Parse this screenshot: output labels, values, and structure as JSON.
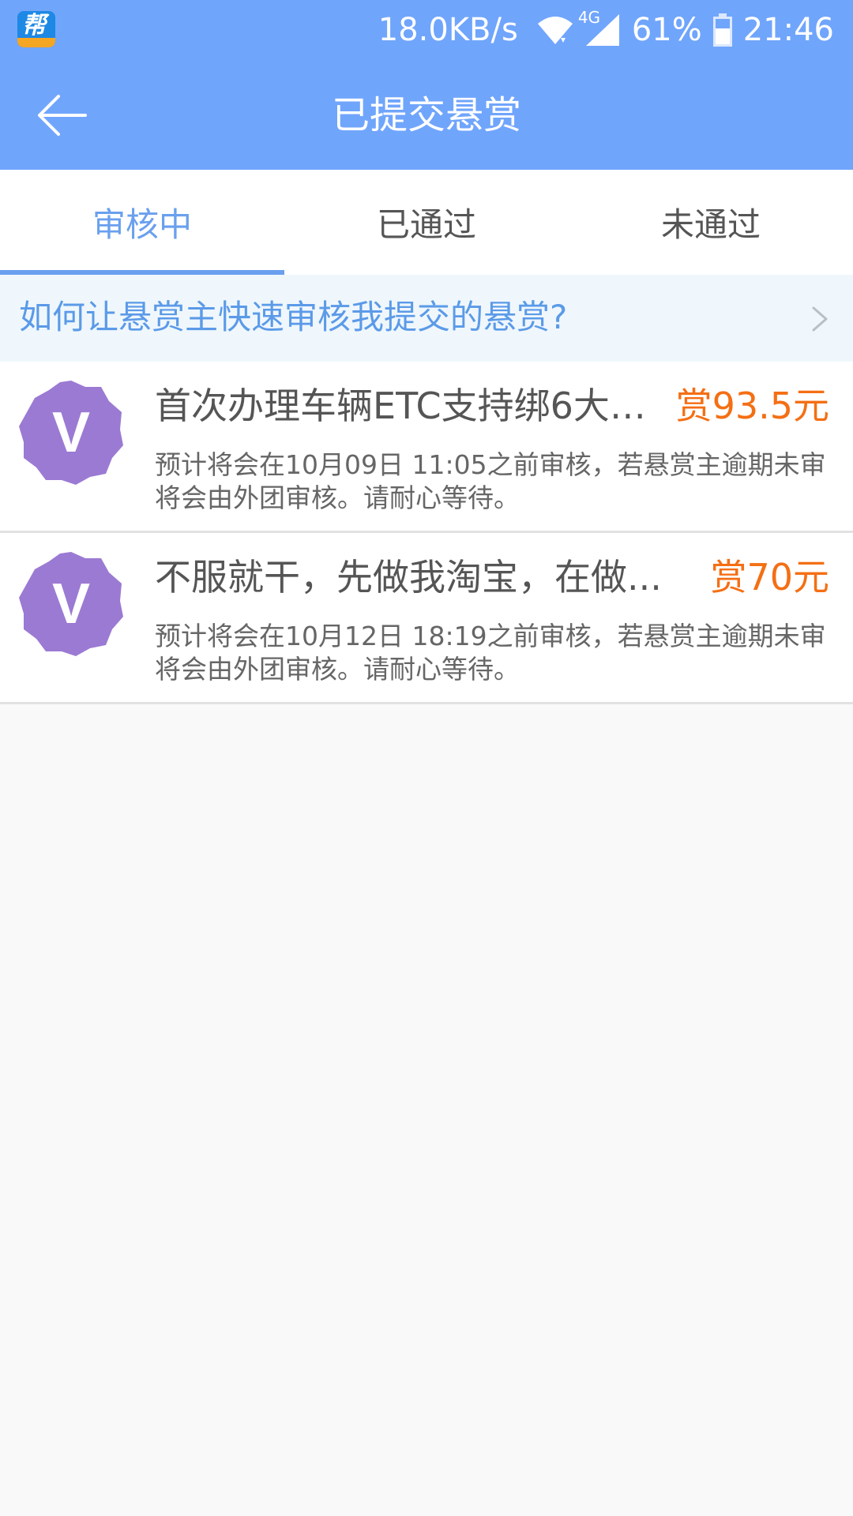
{
  "status_bar": {
    "net_speed": "18.0KB/s",
    "network_type": "4G",
    "battery": "61%",
    "time": "21:46",
    "icons": [
      "app-icon",
      "wifi-icon",
      "signal-icon",
      "battery-icon"
    ]
  },
  "header": {
    "title": "已提交悬赏",
    "back_icon": "arrow-left-icon"
  },
  "tabs": [
    {
      "label": "审核中",
      "active": true
    },
    {
      "label": "已通过",
      "active": false
    },
    {
      "label": "未通过",
      "active": false
    }
  ],
  "help_banner": {
    "text": "如何让悬赏主快速审核我提交的悬赏?",
    "icon": "chevron-right-icon"
  },
  "items": [
    {
      "avatar_letter": "V",
      "title": "首次办理车辆ETC支持绑6大行...",
      "reward": "赏93.5元",
      "desc": "预计将会在10月09日 11:05之前审核，若悬赏主逾期未审将会由外团审核。请耐心等待。"
    },
    {
      "avatar_letter": "V",
      "title": "不服就干，先做我淘宝，在做...",
      "reward": "赏70元",
      "desc": "预计将会在10月12日 18:19之前审核，若悬赏主逾期未审将会由外团审核。请耐心等待。"
    }
  ],
  "colors": {
    "header_bg": "#70a5fc",
    "accent": "#6aa0ee",
    "reward": "#f46f14",
    "avatar": "#9b7ad3",
    "banner_bg": "#eff7fc"
  }
}
